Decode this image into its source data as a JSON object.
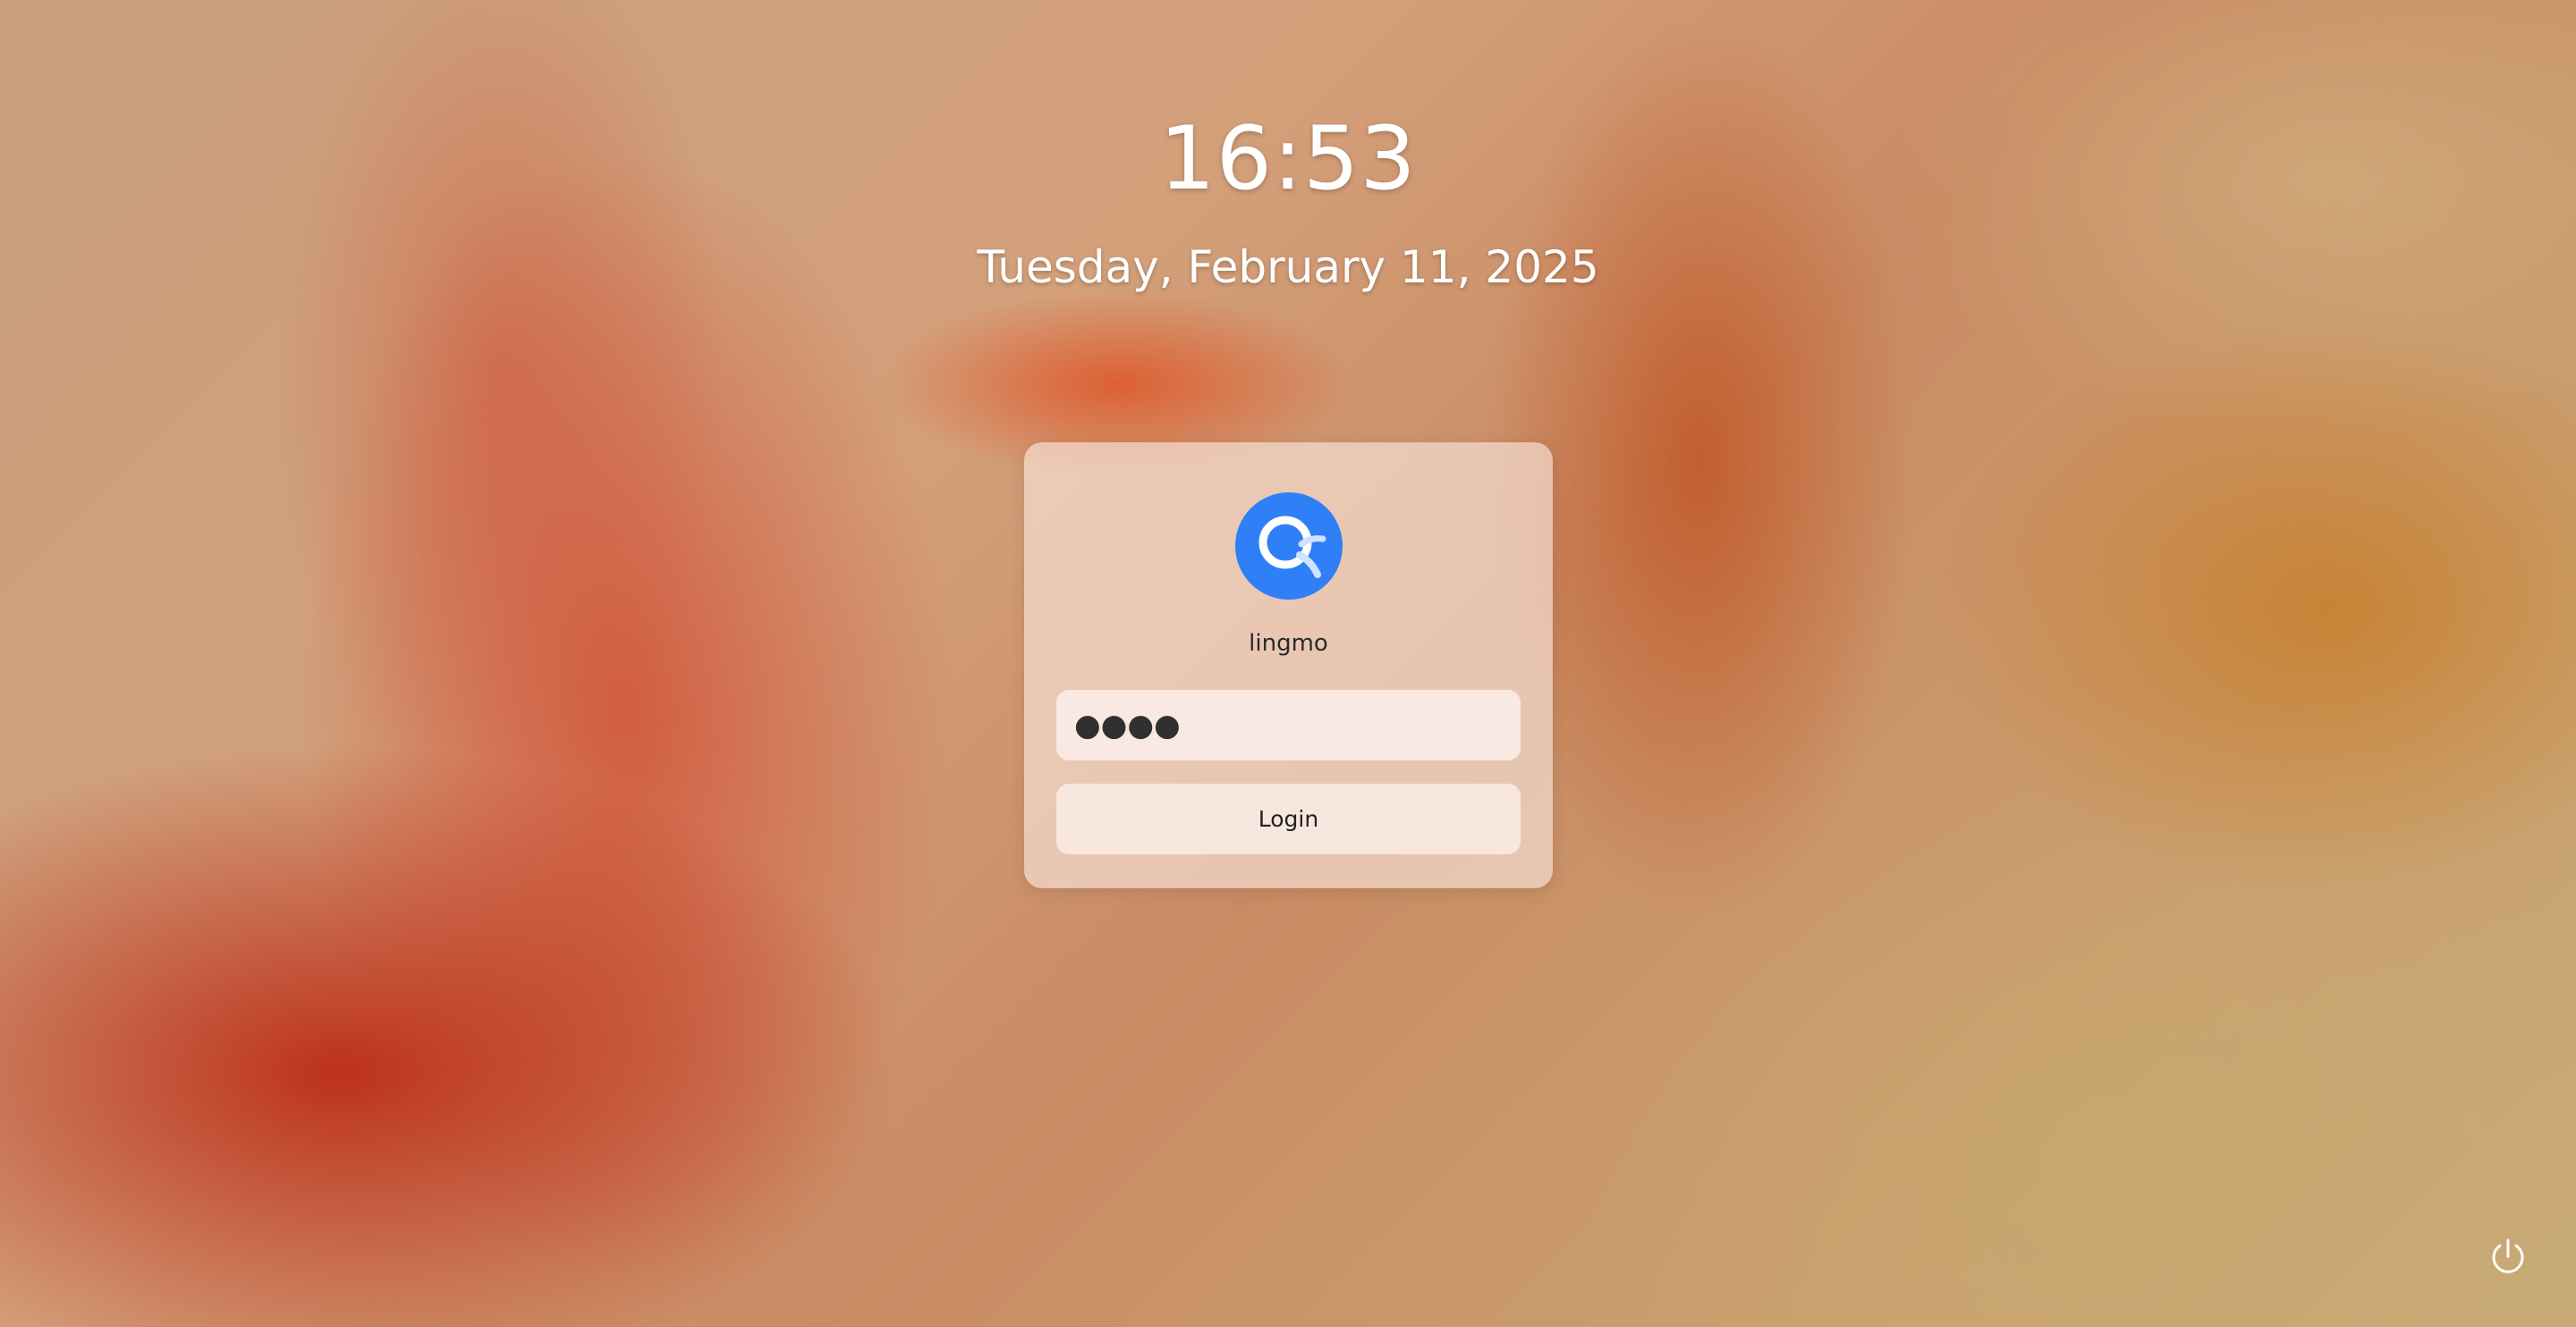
{
  "lockscreen": {
    "time": "16:53",
    "date": "Tuesday, February 11, 2025"
  },
  "login": {
    "avatar_icon": "lingmo-logo-icon",
    "username": "lingmo",
    "password_value": "●●●●",
    "login_label": "Login"
  },
  "system": {
    "power_icon": "power-icon"
  },
  "colors": {
    "avatar_bg": "#2f7ff7",
    "text_light": "#ffffff"
  }
}
